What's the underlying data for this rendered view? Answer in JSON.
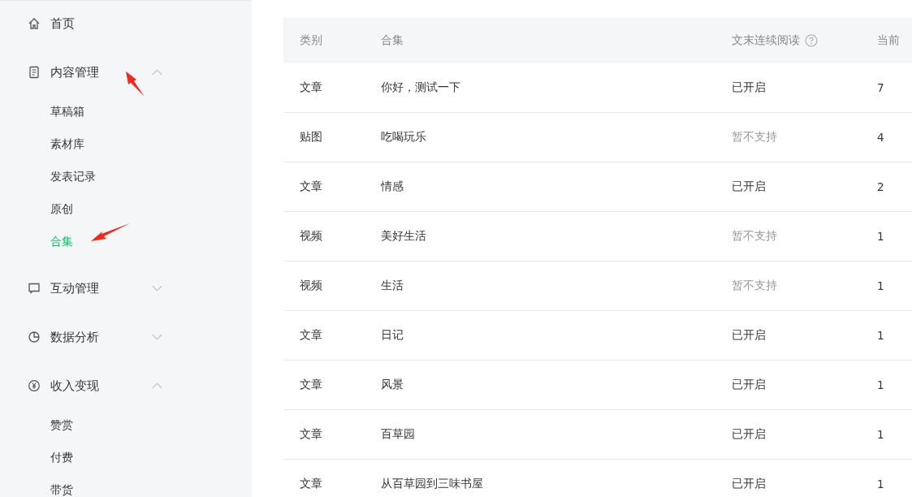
{
  "sidebar": {
    "items": [
      {
        "label": "首页",
        "kind": "home"
      },
      {
        "label": "内容管理",
        "kind": "doc",
        "expanded": true,
        "children": [
          {
            "label": "草稿箱",
            "selected": false
          },
          {
            "label": "素材库",
            "selected": false
          },
          {
            "label": "发表记录",
            "selected": false
          },
          {
            "label": "原创",
            "selected": false
          },
          {
            "label": "合集",
            "selected": true
          }
        ]
      },
      {
        "label": "互动管理",
        "kind": "chat",
        "expanded": false
      },
      {
        "label": "数据分析",
        "kind": "pie",
        "expanded": false
      },
      {
        "label": "收入变现",
        "kind": "yen",
        "expanded": true,
        "children": [
          {
            "label": "赞赏",
            "selected": false
          },
          {
            "label": "付费",
            "selected": false
          },
          {
            "label": "带货",
            "selected": false
          }
        ]
      }
    ]
  },
  "table": {
    "columns": [
      "类别",
      "合集",
      "文末连续阅读",
      "当前"
    ],
    "rows": [
      {
        "type": "文章",
        "name": "你好，测试一下",
        "status": "已开启",
        "supported": true,
        "count": "7"
      },
      {
        "type": "贴图",
        "name": "吃喝玩乐",
        "status": "暂不支持",
        "supported": false,
        "count": "4"
      },
      {
        "type": "文章",
        "name": "情感",
        "status": "已开启",
        "supported": true,
        "count": "2"
      },
      {
        "type": "视频",
        "name": "美好生活",
        "status": "暂不支持",
        "supported": false,
        "count": "1"
      },
      {
        "type": "视频",
        "name": "生活",
        "status": "暂不支持",
        "supported": false,
        "count": "1"
      },
      {
        "type": "文章",
        "name": "日记",
        "status": "已开启",
        "supported": true,
        "count": "1"
      },
      {
        "type": "文章",
        "name": "风景",
        "status": "已开启",
        "supported": true,
        "count": "1"
      },
      {
        "type": "文章",
        "name": "百草园",
        "status": "已开启",
        "supported": true,
        "count": "1"
      },
      {
        "type": "文章",
        "name": "从百草园到三味书屋",
        "status": "已开启",
        "supported": true,
        "count": "1"
      }
    ]
  }
}
